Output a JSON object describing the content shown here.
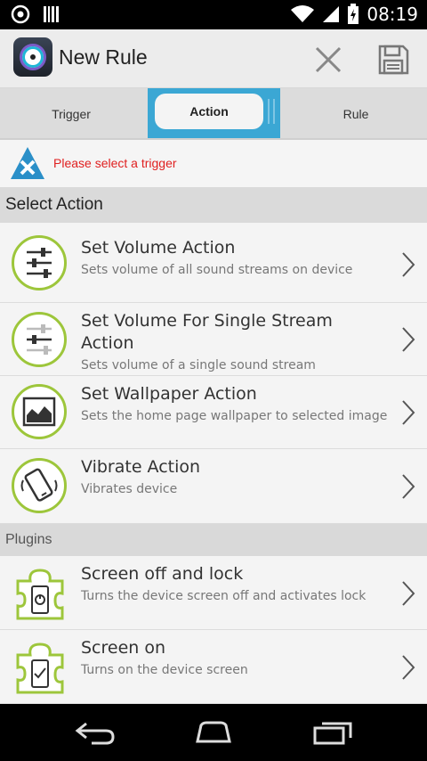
{
  "status_bar": {
    "time": "08:19",
    "icons": [
      "target-icon",
      "barcode-icon",
      "wifi-icon",
      "signal-icon",
      "battery-charging-icon"
    ]
  },
  "action_bar": {
    "title": "New Rule",
    "icons": [
      "app-logo-icon",
      "close-icon",
      "save-icon"
    ]
  },
  "tabs": [
    {
      "label": "Trigger",
      "selected": false
    },
    {
      "label": "Action",
      "selected": true
    },
    {
      "label": "Rule",
      "selected": false
    }
  ],
  "warning": {
    "text": "Please select a trigger",
    "icon": "warning-x-icon",
    "color": "#e02020"
  },
  "sections": {
    "actions_header": "Select Action",
    "plugins_header": "Plugins"
  },
  "actions": [
    {
      "title": "Set Volume Action",
      "subtitle": "Sets volume of all sound streams on device",
      "icon": "volume-sliders-icon"
    },
    {
      "title": "Set Volume For Single Stream Action",
      "title_line1": "Set Volume For Single Stream",
      "title_line2": "Action",
      "subtitle": "Sets volume of a single sound stream",
      "icon": "volume-slider-icon"
    },
    {
      "title": "Set Wallpaper Action",
      "subtitle": "Sets the home page wallpaper to selected image",
      "icon": "wallpaper-icon"
    },
    {
      "title": "Vibrate Action",
      "subtitle": "Vibrates device",
      "icon": "vibrate-icon"
    }
  ],
  "plugins": [
    {
      "title": "Screen off and lock",
      "subtitle": "Turns the device screen off and activates lock",
      "icon": "puzzle-power-icon"
    },
    {
      "title": "Screen on",
      "subtitle": "Turns on the device screen",
      "icon": "puzzle-check-icon"
    }
  ],
  "colors": {
    "accent_tab": "#3ba7d4",
    "icon_green": "#9dc63b",
    "warning_red": "#e02020"
  }
}
